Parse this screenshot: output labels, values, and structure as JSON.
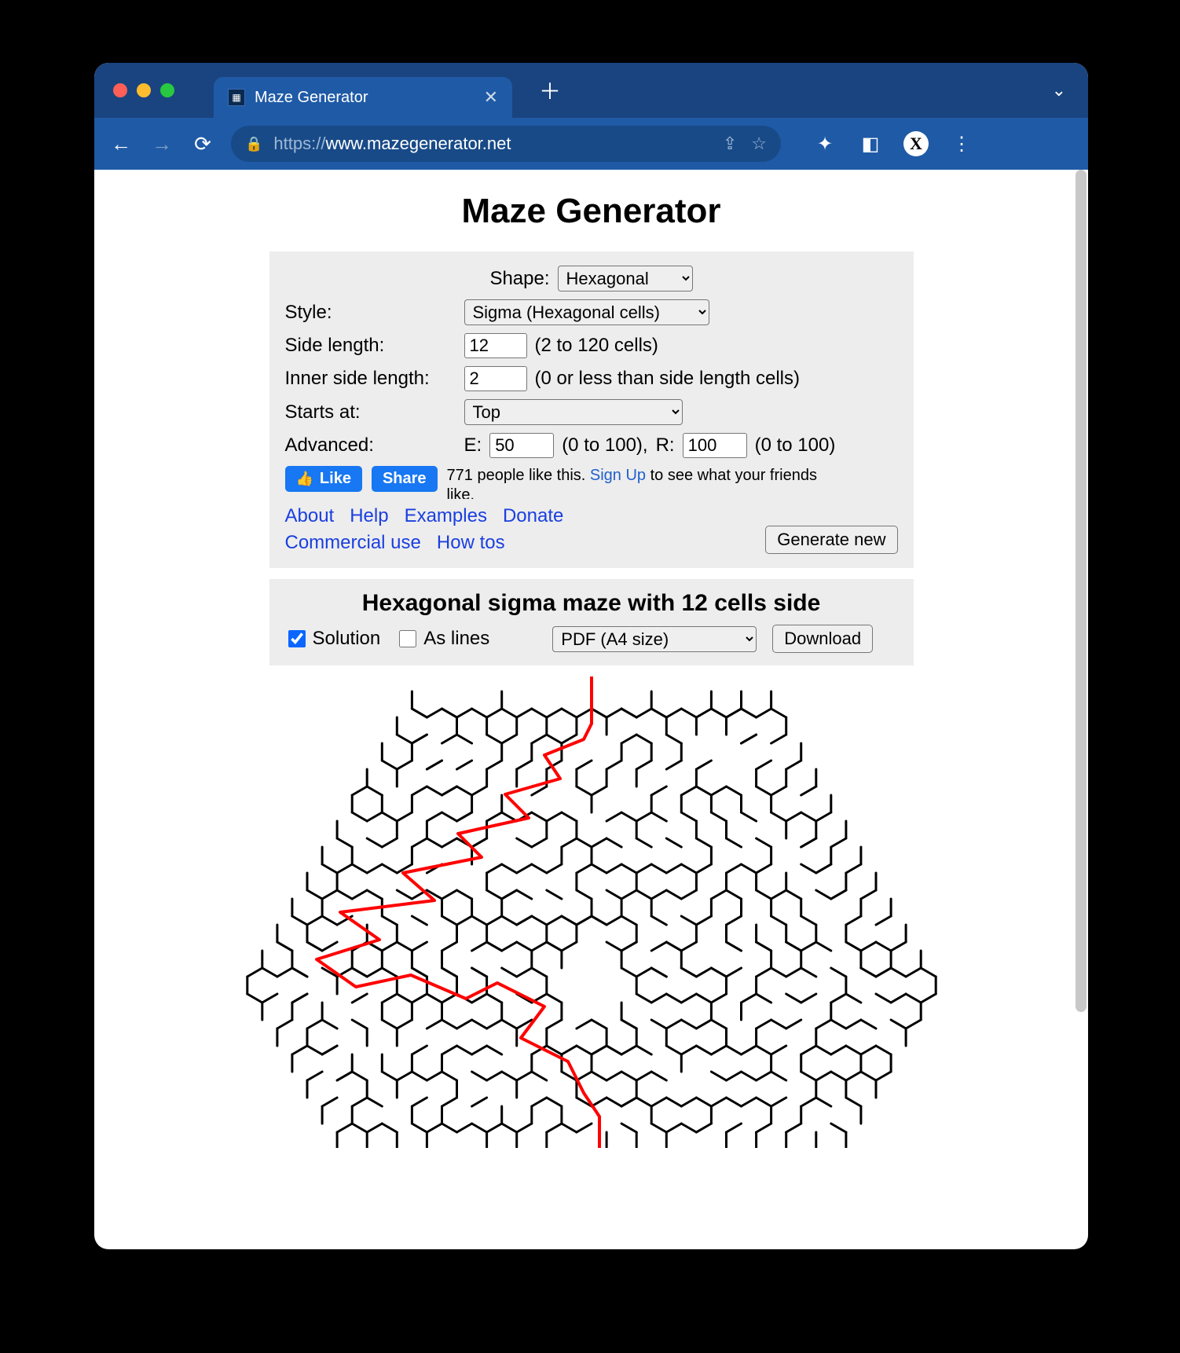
{
  "browser": {
    "tab_title": "Maze Generator",
    "url_scheme": "https://",
    "url_host": "www.mazegenerator.net",
    "avatar_letter": "X"
  },
  "page": {
    "title": "Maze Generator"
  },
  "form": {
    "shape_label": "Shape:",
    "shape_value": "Hexagonal",
    "style_label": "Style:",
    "style_value": "Sigma (Hexagonal cells)",
    "side_length_label": "Side length:",
    "side_length_value": "12",
    "side_length_hint": "(2 to 120 cells)",
    "inner_side_label": "Inner side length:",
    "inner_side_value": "2",
    "inner_side_hint": "(0 or less than side length cells)",
    "starts_at_label": "Starts at:",
    "starts_at_value": "Top",
    "advanced_label": "Advanced:",
    "advanced_e_label": "E:",
    "advanced_e_value": "50",
    "advanced_e_hint": "(0 to 100),",
    "advanced_r_label": "R:",
    "advanced_r_value": "100",
    "advanced_r_hint": "(0 to 100)",
    "generate_label": "Generate new"
  },
  "fb": {
    "like_label": "Like",
    "share_label": "Share",
    "text_prefix": "771 people like this. ",
    "signup_label": "Sign Up",
    "text_suffix": " to see what your friends like."
  },
  "links": {
    "about": "About",
    "help": "Help",
    "examples": "Examples",
    "donate": "Donate",
    "commercial": "Commercial use",
    "howtos": "How tos"
  },
  "result": {
    "title": "Hexagonal sigma maze with 12 cells side",
    "solution_label": "Solution",
    "solution_checked": true,
    "aslines_label": "As lines",
    "aslines_checked": false,
    "format_value": "PDF (A4 size)",
    "download_label": "Download"
  }
}
